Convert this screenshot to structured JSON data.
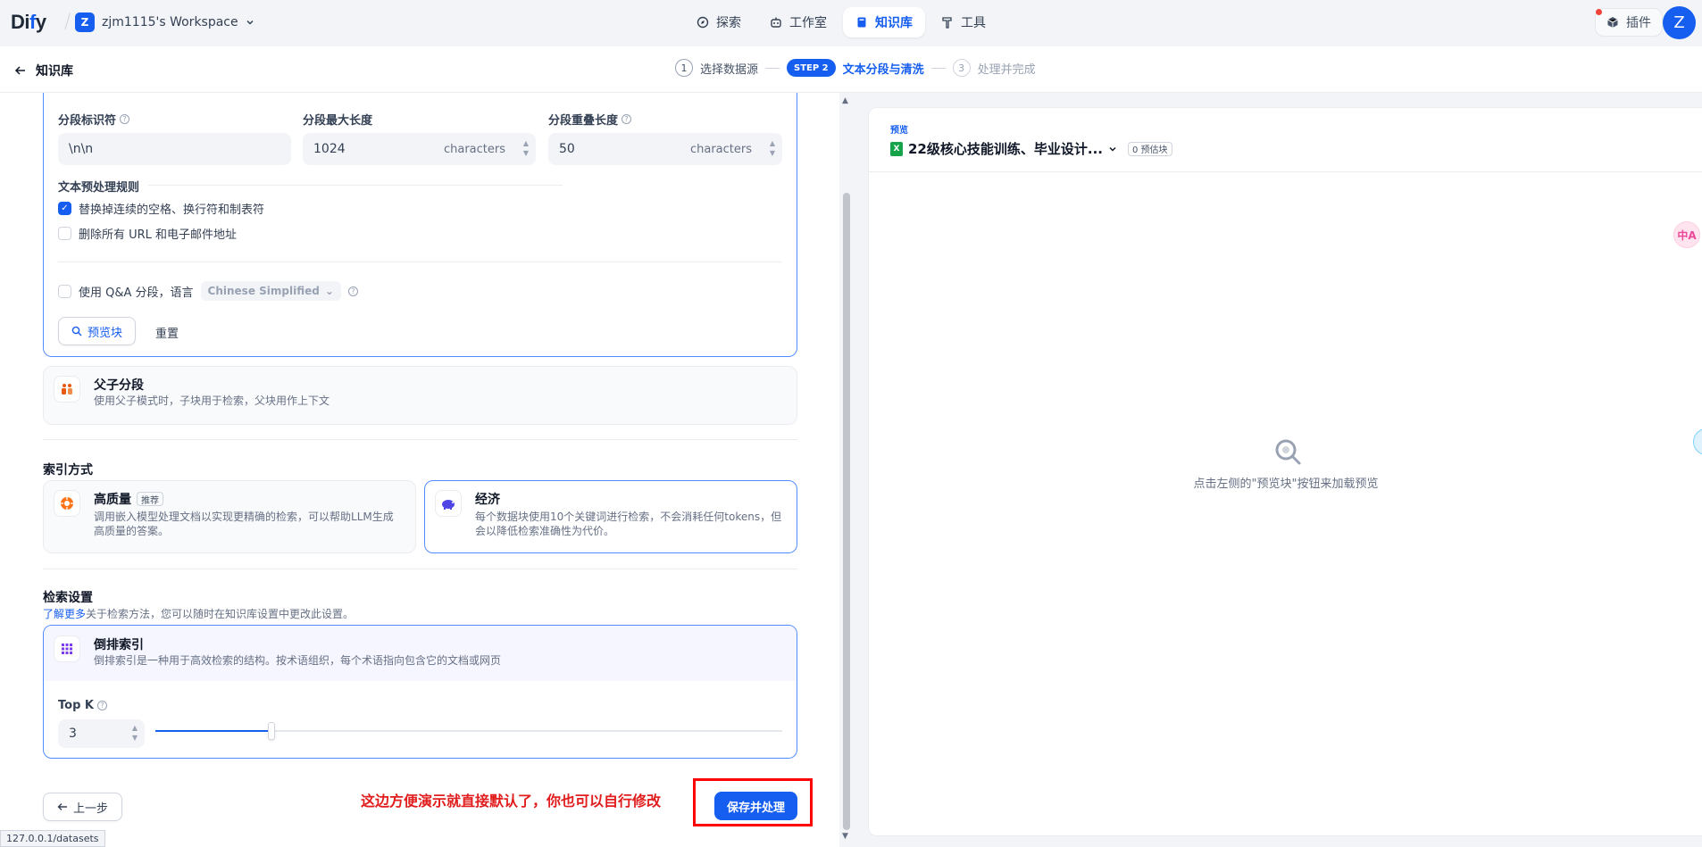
{
  "topbar": {
    "logo": "Dify",
    "workspace_badge": "Z",
    "workspace_name": "zjm1115's Workspace",
    "nav": [
      {
        "label": "探索",
        "icon": "compass-icon"
      },
      {
        "label": "工作室",
        "icon": "robot-icon"
      },
      {
        "label": "知识库",
        "icon": "book-icon",
        "active": true
      },
      {
        "label": "工具",
        "icon": "hammer-icon"
      }
    ],
    "plugins_label": "插件",
    "avatar": "Z"
  },
  "stepbar": {
    "back_label": "知识库",
    "steps": [
      {
        "num": "1",
        "label": "选择数据源",
        "state": "done"
      },
      {
        "num": "STEP 2",
        "label": "文本分段与清洗",
        "state": "active"
      },
      {
        "num": "3",
        "label": "处理并完成",
        "state": "pending"
      }
    ]
  },
  "segment": {
    "identifier_label": "分段标识符",
    "identifier_value": "\\n\\n",
    "max_length_label": "分段最大长度",
    "max_length_value": "1024",
    "max_length_unit": "characters",
    "overlap_label": "分段重叠长度",
    "overlap_value": "50",
    "overlap_unit": "characters",
    "preprocess_label": "文本预处理规则",
    "rule_replace": "替换掉连续的空格、换行符和制表符",
    "rule_replace_checked": true,
    "rule_remove_urls": "删除所有 URL 和电子邮件地址",
    "rule_remove_urls_checked": false,
    "qa_label": "使用 Q&A 分段，语言",
    "qa_language": "Chinese Simplified",
    "preview_button": "预览块",
    "reset_button": "重置"
  },
  "parent_child": {
    "title": "父子分段",
    "desc": "使用父子模式时，子块用于检索，父块用作上下文"
  },
  "index": {
    "section_title": "索引方式",
    "high_quality_title": "高质量",
    "high_quality_tag": "推荐",
    "high_quality_desc_1": "调用嵌入模型处理文档以实现更精确的检索，可以帮助LLM生成",
    "high_quality_desc_2": "高质量的答案。",
    "economy_title": "经济",
    "economy_desc_1": "每个数据块使用10个关键词进行检索，不会消耗任何tokens，但",
    "economy_desc_2": "会以降低检索准确性为代价。"
  },
  "retrieval": {
    "section_title": "检索设置",
    "learn_more": "了解更多",
    "hint": "关于检索方法，您可以随时在知识库设置中更改此设置。",
    "method_title": "倒排索引",
    "method_desc": "倒排索引是一种用于高效检索的结构。按术语组织，每个术语指向包含它的文档或网页",
    "topk_label": "Top K",
    "topk_value": "3",
    "topk_slider_fraction": 0.185
  },
  "footer": {
    "prev_button": "上一步",
    "annotation": "这边方便演示就直接默认了，你也可以自行修改",
    "save_button": "保存并处理"
  },
  "statusbar": "127.0.0.1/datasets",
  "preview": {
    "label": "预览",
    "file_name": "22级核心技能训练、毕业设计...",
    "chunks_badge": "0 预估块",
    "empty_text": "点击左侧的\"预览块\"按钮来加载预览"
  },
  "floats": {
    "translate_label": "中A"
  }
}
